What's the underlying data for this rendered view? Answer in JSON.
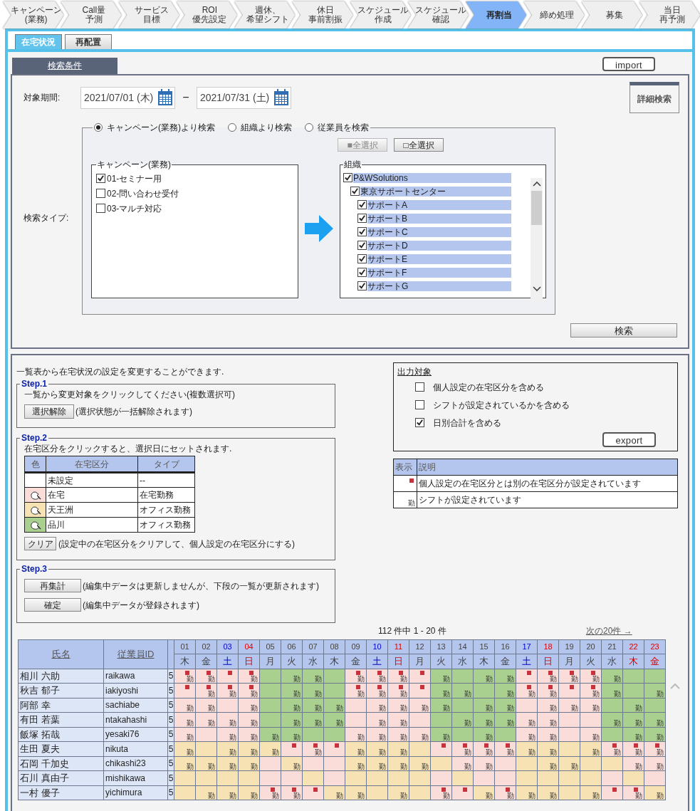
{
  "nav_tabs": [
    {
      "lines": [
        "キャンペーン",
        "(業務)"
      ],
      "selected": false
    },
    {
      "lines": [
        "Call量",
        "予測"
      ],
      "selected": false
    },
    {
      "lines": [
        "サービス",
        "目標"
      ],
      "selected": false
    },
    {
      "lines": [
        "ROI",
        "優先設定"
      ],
      "selected": false
    },
    {
      "lines": [
        "週休、",
        "希望シフト"
      ],
      "selected": false
    },
    {
      "lines": [
        "休日",
        "事前割振"
      ],
      "selected": false
    },
    {
      "lines": [
        "スケジュール",
        "作成"
      ],
      "selected": false
    },
    {
      "lines": [
        "スケジュール",
        "確認"
      ],
      "selected": false
    },
    {
      "lines": [
        "再割当"
      ],
      "selected": true
    },
    {
      "lines": [
        "締め処理"
      ],
      "selected": false
    },
    {
      "lines": [
        "募集"
      ],
      "selected": false
    },
    {
      "lines": [
        "当日",
        "再予測"
      ],
      "selected": false
    }
  ],
  "sub_tabs": [
    {
      "label": "在宅状況",
      "selected": true
    },
    {
      "label": "再配置",
      "selected": false
    }
  ],
  "search_panel": {
    "title": "検索条件",
    "import_button": "import",
    "detail_search_button": "詳細検索",
    "period_label": "対象期間:",
    "date_from": "2021/07/01 (木)",
    "separator": "−",
    "date_to": "2021/07/31 (土)",
    "type_label": "検索タイプ:",
    "search_types": [
      {
        "label": "キャンペーン(業務)より検索",
        "selected": true
      },
      {
        "label": "組織より検索",
        "selected": false
      },
      {
        "label": "従業員を検索",
        "selected": false
      }
    ],
    "select_all_button": {
      "label": "■全選択",
      "disabled": true
    },
    "deselect_all_button": {
      "label": "□全選択",
      "disabled": false
    },
    "campaign_list": {
      "title": "キャンペーン(業務)",
      "items": [
        {
          "label": "01-セミナー用",
          "checked": true
        },
        {
          "label": "02-問い合わせ受付",
          "checked": false
        },
        {
          "label": "03-マルチ対応",
          "checked": false
        }
      ]
    },
    "org_list": {
      "title": "組織",
      "items": [
        {
          "label": "P&WSolutions",
          "checked": true,
          "children": [
            {
              "label": "東京サポートセンター",
              "checked": true,
              "children": [
                {
                  "label": "サポートA",
                  "checked": true
                },
                {
                  "label": "サポートB",
                  "checked": true
                },
                {
                  "label": "サポートC",
                  "checked": true
                },
                {
                  "label": "サポートD",
                  "checked": true
                },
                {
                  "label": "サポートE",
                  "checked": true
                },
                {
                  "label": "サポートF",
                  "checked": true
                },
                {
                  "label": "サポートG",
                  "checked": true
                }
              ]
            }
          ]
        }
      ]
    },
    "search_button": "検索"
  },
  "intro": "一覧表から在宅状況の設定を変更することができます.",
  "step1": {
    "title": "Step.1",
    "instruction": "一覧から変更対象をクリックしてください(複数選択可)",
    "button": "選択解除",
    "note": "(選択状態が一括解除されます)"
  },
  "step2": {
    "title": "Step.2",
    "instruction": "在宅区分をクリックすると、選択日にセットされます.",
    "columns": [
      "色",
      "在宅区分",
      "タイプ"
    ],
    "rows": [
      {
        "kind": "unset",
        "color": "#ffffff",
        "zone": "未設定",
        "type": "--"
      },
      {
        "kind": "zone",
        "color": "#fadcd9",
        "zone": "在宅",
        "type": "在宅勤務"
      },
      {
        "kind": "zone",
        "color": "#f6e2b3",
        "zone": "天王洲",
        "type": "オフィス勤務"
      },
      {
        "kind": "zone",
        "color": "#a9d08e",
        "zone": "品川",
        "type": "オフィス勤務"
      }
    ],
    "button": "クリア",
    "note": "(設定中の在宅区分をクリアして、個人設定の在宅区分にする)"
  },
  "step3": {
    "title": "Step.3",
    "actions": [
      {
        "button": "再集計",
        "note": "(編集中データは更新しませんが、下段の一覧が更新されます)"
      },
      {
        "button": "確定",
        "note": "(編集中データが登録されます)"
      }
    ]
  },
  "output": {
    "title": "出力対象",
    "options": [
      {
        "label": "個人設定の在宅区分を含める",
        "checked": false
      },
      {
        "label": "シフトが設定されているかを含める",
        "checked": false
      },
      {
        "label": "日別合計を含める",
        "checked": true
      }
    ],
    "export_button": "export"
  },
  "legend": {
    "columns": [
      "表示",
      "説明"
    ],
    "rows": [
      {
        "kind": "mark",
        "description": "個人設定の在宅区分とは別の在宅区分が設定されています"
      },
      {
        "kind": "shift",
        "symbol": "勤",
        "description": "シフトが設定されています"
      }
    ]
  },
  "pagination": {
    "summary": "112 件中 1 - 20 件",
    "next_link": "次の20件 →"
  },
  "table": {
    "columns": [
      "氏名",
      "従業員ID"
    ],
    "days": [
      {
        "day": "01",
        "weekday": "木",
        "kind": "weekday"
      },
      {
        "day": "02",
        "weekday": "金",
        "kind": "weekday"
      },
      {
        "day": "03",
        "weekday": "土",
        "kind": "saturday"
      },
      {
        "day": "04",
        "weekday": "日",
        "kind": "holiday"
      },
      {
        "day": "05",
        "weekday": "月",
        "kind": "weekday"
      },
      {
        "day": "06",
        "weekday": "火",
        "kind": "weekday"
      },
      {
        "day": "07",
        "weekday": "水",
        "kind": "weekday"
      },
      {
        "day": "08",
        "weekday": "木",
        "kind": "weekday"
      },
      {
        "day": "09",
        "weekday": "金",
        "kind": "weekday"
      },
      {
        "day": "10",
        "weekday": "土",
        "kind": "saturday"
      },
      {
        "day": "11",
        "weekday": "日",
        "kind": "holiday"
      },
      {
        "day": "12",
        "weekday": "月",
        "kind": "weekday"
      },
      {
        "day": "13",
        "weekday": "火",
        "kind": "weekday"
      },
      {
        "day": "14",
        "weekday": "水",
        "kind": "weekday"
      },
      {
        "day": "15",
        "weekday": "木",
        "kind": "weekday"
      },
      {
        "day": "16",
        "weekday": "金",
        "kind": "weekday"
      },
      {
        "day": "17",
        "weekday": "土",
        "kind": "saturday"
      },
      {
        "day": "18",
        "weekday": "日",
        "kind": "holiday"
      },
      {
        "day": "19",
        "weekday": "月",
        "kind": "weekday"
      },
      {
        "day": "20",
        "weekday": "火",
        "kind": "weekday"
      },
      {
        "day": "21",
        "weekday": "水",
        "kind": "weekday"
      },
      {
        "day": "22",
        "weekday": "木",
        "kind": "holiday"
      },
      {
        "day": "23",
        "weekday": "金",
        "kind": "holiday"
      }
    ],
    "rows": [
      {
        "name": "相川 六助",
        "id": "raikawa",
        "count": "5",
        "cells": [
          {
            "color": "#fadcd9",
            "changed": true,
            "shift": "勤"
          },
          {
            "color": "#fadcd9",
            "changed": true,
            "shift": "勤"
          },
          {
            "color": "#fadcd9",
            "changed": true
          },
          {
            "color": "#fadcd9",
            "changed": true,
            "shift": "勤"
          },
          {
            "color": "#a9d08e",
            "changed": false
          },
          {
            "color": "#a9d08e",
            "changed": false,
            "shift": "勤"
          },
          {
            "color": "#a9d08e",
            "changed": false,
            "shift": "勤"
          },
          {
            "color": "#a9d08e",
            "changed": false
          },
          {
            "color": "#fadcd9",
            "changed": true,
            "shift": "勤"
          },
          {
            "color": "#fadcd9",
            "changed": true,
            "shift": "勤"
          },
          {
            "color": "#fadcd9",
            "changed": true,
            "shift": "勤"
          },
          {
            "color": "#fadcd9",
            "changed": true
          },
          {
            "color": "#a9d08e",
            "changed": false,
            "shift": "勤"
          },
          {
            "color": "#a9d08e",
            "changed": false
          },
          {
            "color": "#a9d08e",
            "changed": false,
            "shift": "勤"
          },
          {
            "color": "#a9d08e",
            "changed": false,
            "shift": "勤"
          },
          {
            "color": "#fadcd9",
            "changed": true
          },
          {
            "color": "#fadcd9",
            "changed": true,
            "shift": "勤"
          },
          {
            "color": "#fadcd9",
            "changed": true,
            "shift": "勤"
          },
          {
            "color": "#fadcd9",
            "changed": true,
            "shift": "勤"
          },
          {
            "color": "#a9d08e",
            "changed": false,
            "shift": "勤"
          },
          {
            "color": "#a9d08e",
            "changed": false
          },
          {
            "color": "#a9d08e",
            "changed": false
          }
        ]
      },
      {
        "name": "秋吉 郁子",
        "id": "iakiyoshi",
        "count": "5",
        "cells": [
          {
            "color": "#fadcd9",
            "changed": true
          },
          {
            "color": "#fadcd9",
            "changed": true,
            "shift": "勤"
          },
          {
            "color": "#fadcd9",
            "changed": true,
            "shift": "勤"
          },
          {
            "color": "#fadcd9",
            "changed": true,
            "shift": "勤"
          },
          {
            "color": "#a9d08e",
            "changed": false
          },
          {
            "color": "#a9d08e",
            "changed": false,
            "shift": "勤"
          },
          {
            "color": "#a9d08e",
            "changed": false,
            "shift": "勤"
          },
          {
            "color": "#a9d08e",
            "changed": false
          },
          {
            "color": "#fadcd9",
            "changed": true,
            "shift": "勤"
          },
          {
            "color": "#fadcd9",
            "changed": true,
            "shift": "勤"
          },
          {
            "color": "#fadcd9",
            "changed": true,
            "shift": "勤"
          },
          {
            "color": "#fadcd9",
            "changed": true
          },
          {
            "color": "#a9d08e",
            "changed": false,
            "shift": "勤"
          },
          {
            "color": "#a9d08e",
            "changed": false,
            "shift": "勤"
          },
          {
            "color": "#a9d08e",
            "changed": false
          },
          {
            "color": "#a9d08e",
            "changed": false,
            "shift": "勤"
          },
          {
            "color": "#fadcd9",
            "changed": true,
            "shift": "勤"
          },
          {
            "color": "#fadcd9",
            "changed": true,
            "shift": "勤"
          },
          {
            "color": "#fadcd9",
            "changed": true
          },
          {
            "color": "#fadcd9",
            "changed": true,
            "shift": "勤"
          },
          {
            "color": "#a9d08e",
            "changed": false,
            "shift": "勤"
          },
          {
            "color": "#a9d08e",
            "changed": false
          },
          {
            "color": "#a9d08e",
            "changed": false,
            "shift": "勤"
          }
        ]
      },
      {
        "name": "阿部 幸",
        "id": "sachiabe",
        "count": "5",
        "cells": [
          {
            "color": "#fadcd9",
            "changed": false,
            "shift": "勤"
          },
          {
            "color": "#fadcd9",
            "changed": false,
            "shift": "勤"
          },
          {
            "color": "#fadcd9",
            "changed": false
          },
          {
            "color": "#fadcd9",
            "changed": false,
            "shift": "勤"
          },
          {
            "color": "#a9d08e",
            "changed": false
          },
          {
            "color": "#a9d08e",
            "changed": false,
            "shift": "勤"
          },
          {
            "color": "#a9d08e",
            "changed": false,
            "shift": "勤"
          },
          {
            "color": "#a9d08e",
            "changed": false,
            "shift": "勤"
          },
          {
            "color": "#fadcd9",
            "changed": false
          },
          {
            "color": "#fadcd9",
            "changed": false,
            "shift": "勤"
          },
          {
            "color": "#fadcd9",
            "changed": false,
            "shift": "勤"
          },
          {
            "color": "#fadcd9",
            "changed": false,
            "shift": "勤"
          },
          {
            "color": "#a9d08e",
            "changed": false,
            "shift": "勤"
          },
          {
            "color": "#a9d08e",
            "changed": false
          },
          {
            "color": "#a9d08e",
            "changed": false,
            "shift": "勤"
          },
          {
            "color": "#a9d08e",
            "changed": false,
            "shift": "勤"
          },
          {
            "color": "#fadcd9",
            "changed": false
          },
          {
            "color": "#fadcd9",
            "changed": false,
            "shift": "勤"
          },
          {
            "color": "#fadcd9",
            "changed": false,
            "shift": "勤"
          },
          {
            "color": "#fadcd9",
            "changed": false,
            "shift": "勤"
          },
          {
            "color": "#a9d08e",
            "changed": false
          },
          {
            "color": "#a9d08e",
            "changed": false,
            "shift": "勤"
          },
          {
            "color": "#a9d08e",
            "changed": false
          }
        ]
      },
      {
        "name": "有田 若葉",
        "id": "ntakahashi",
        "count": "5",
        "cells": [
          {
            "color": "#fadcd9",
            "changed": false,
            "shift": "勤"
          },
          {
            "color": "#fadcd9",
            "changed": false,
            "shift": "勤"
          },
          {
            "color": "#fadcd9",
            "changed": false,
            "shift": "勤"
          },
          {
            "color": "#fadcd9",
            "changed": false,
            "shift": "勤"
          },
          {
            "color": "#a9d08e",
            "changed": false
          },
          {
            "color": "#a9d08e",
            "changed": false,
            "shift": "勤"
          },
          {
            "color": "#a9d08e",
            "changed": false,
            "shift": "勤"
          },
          {
            "color": "#a9d08e",
            "changed": false,
            "shift": "勤"
          },
          {
            "color": "#fadcd9",
            "changed": false
          },
          {
            "color": "#fadcd9",
            "changed": false,
            "shift": "勤"
          },
          {
            "color": "#fadcd9",
            "changed": false,
            "shift": "勤"
          },
          {
            "color": "#fadcd9",
            "changed": false
          },
          {
            "color": "#a9d08e",
            "changed": false
          },
          {
            "color": "#a9d08e",
            "changed": false,
            "shift": "勤"
          },
          {
            "color": "#a9d08e",
            "changed": false,
            "shift": "勤"
          },
          {
            "color": "#a9d08e",
            "changed": false,
            "shift": "勤"
          },
          {
            "color": "#fadcd9",
            "changed": false,
            "shift": "勤"
          },
          {
            "color": "#fadcd9",
            "changed": false,
            "shift": "勤"
          },
          {
            "color": "#fadcd9",
            "changed": false
          },
          {
            "color": "#fadcd9",
            "changed": false
          },
          {
            "color": "#a9d08e",
            "changed": false,
            "shift": "勤"
          },
          {
            "color": "#a9d08e",
            "changed": false,
            "shift": "勤"
          },
          {
            "color": "#a9d08e",
            "changed": false,
            "shift": "勤"
          }
        ]
      },
      {
        "name": "飯塚 拓哉",
        "id": "yesaki76",
        "count": "5",
        "cells": [
          {
            "color": "#fadcd9",
            "changed": false,
            "shift": "勤"
          },
          {
            "color": "#fadcd9",
            "changed": false
          },
          {
            "color": "#fadcd9",
            "changed": false,
            "shift": "勤"
          },
          {
            "color": "#fadcd9",
            "changed": false,
            "shift": "勤"
          },
          {
            "color": "#a9d08e",
            "changed": false,
            "shift": "勤"
          },
          {
            "color": "#a9d08e",
            "changed": false,
            "shift": "勤"
          },
          {
            "color": "#a9d08e",
            "changed": false
          },
          {
            "color": "#a9d08e",
            "changed": false
          },
          {
            "color": "#fadcd9",
            "changed": false,
            "shift": "勤"
          },
          {
            "color": "#fadcd9",
            "changed": false,
            "shift": "勤"
          },
          {
            "color": "#fadcd9",
            "changed": false,
            "shift": "勤"
          },
          {
            "color": "#fadcd9",
            "changed": false,
            "shift": "勤"
          },
          {
            "color": "#a9d08e",
            "changed": false,
            "shift": "勤"
          },
          {
            "color": "#a9d08e",
            "changed": false
          },
          {
            "color": "#a9d08e",
            "changed": false,
            "shift": "勤"
          },
          {
            "color": "#a9d08e",
            "changed": false
          },
          {
            "color": "#fadcd9",
            "changed": false,
            "shift": "勤"
          },
          {
            "color": "#fadcd9",
            "changed": false,
            "shift": "勤"
          },
          {
            "color": "#fadcd9",
            "changed": false
          },
          {
            "color": "#fadcd9",
            "changed": false,
            "shift": "勤"
          },
          {
            "color": "#a9d08e",
            "changed": false
          },
          {
            "color": "#a9d08e",
            "changed": false,
            "shift": "勤"
          },
          {
            "color": "#a9d08e",
            "changed": false,
            "shift": "勤"
          }
        ]
      },
      {
        "name": "生田 夏夫",
        "id": "nikuta",
        "count": "5",
        "cells": [
          {
            "color": "#f6e2b3",
            "changed": false,
            "shift": "勤"
          },
          {
            "color": "#f6e2b3",
            "changed": false
          },
          {
            "color": "#f6e2b3",
            "changed": false,
            "shift": "勤"
          },
          {
            "color": "#f6e2b3",
            "changed": false,
            "shift": "勤"
          },
          {
            "color": "#f6e2b3",
            "changed": false,
            "shift": "勤"
          },
          {
            "color": "#fadcd9",
            "changed": true
          },
          {
            "color": "#fadcd9",
            "changed": true,
            "shift": "勤"
          },
          {
            "color": "#fadcd9",
            "changed": true
          },
          {
            "color": "#f6e2b3",
            "changed": false,
            "shift": "勤"
          },
          {
            "color": "#f6e2b3",
            "changed": false,
            "shift": "勤"
          },
          {
            "color": "#f6e2b3",
            "changed": false,
            "shift": "勤"
          },
          {
            "color": "#f6e2b3",
            "changed": false
          },
          {
            "color": "#fadcd9",
            "changed": true
          },
          {
            "color": "#fadcd9",
            "changed": true,
            "shift": "勤"
          },
          {
            "color": "#fadcd9",
            "changed": true,
            "shift": "勤"
          },
          {
            "color": "#fadcd9",
            "changed": true,
            "shift": "勤"
          },
          {
            "color": "#f6e2b3",
            "changed": false,
            "shift": "勤"
          },
          {
            "color": "#f6e2b3",
            "changed": false,
            "shift": "勤"
          },
          {
            "color": "#f6e2b3",
            "changed": false
          },
          {
            "color": "#f6e2b3",
            "changed": false,
            "shift": "勤"
          },
          {
            "color": "#fadcd9",
            "changed": true,
            "shift": "勤"
          },
          {
            "color": "#fadcd9",
            "changed": true,
            "shift": "勤"
          },
          {
            "color": "#fadcd9",
            "changed": true,
            "shift": "勤"
          }
        ]
      },
      {
        "name": "石岡 千加史",
        "id": "chikashi23",
        "count": "5",
        "cells": [
          {
            "color": "#f6e2b3",
            "changed": false,
            "shift": "勤"
          },
          {
            "color": "#f6e2b3",
            "changed": false,
            "shift": "勤"
          },
          {
            "color": "#f6e2b3",
            "changed": false,
            "shift": "勤"
          },
          {
            "color": "#f6e2b3",
            "changed": false,
            "shift": "勤"
          },
          {
            "color": "#fadcd9",
            "changed": false
          },
          {
            "color": "#f6e2b3",
            "changed": false,
            "shift": "勤"
          },
          {
            "color": "#fadcd9",
            "changed": false
          },
          {
            "color": "#fadcd9",
            "changed": false
          },
          {
            "color": "#f6e2b3",
            "changed": false,
            "shift": "勤"
          },
          {
            "color": "#f6e2b3",
            "changed": false,
            "shift": "勤"
          },
          {
            "color": "#f6e2b3",
            "changed": false,
            "shift": "勤"
          },
          {
            "color": "#f6e2b3",
            "changed": false,
            "shift": "勤"
          },
          {
            "color": "#f6e2b3",
            "changed": false
          },
          {
            "color": "#fadcd9",
            "changed": false,
            "shift": "勤"
          },
          {
            "color": "#fadcd9",
            "changed": false,
            "shift": "勤"
          },
          {
            "color": "#fadcd9",
            "changed": false
          },
          {
            "color": "#f6e2b3",
            "changed": false
          },
          {
            "color": "#f6e2b3",
            "changed": false,
            "shift": "勤"
          },
          {
            "color": "#f6e2b3",
            "changed": false,
            "shift": "勤"
          },
          {
            "color": "#f6e2b3",
            "changed": false
          },
          {
            "color": "#f6e2b3",
            "changed": false
          },
          {
            "color": "#fadcd9",
            "changed": false,
            "shift": "勤"
          },
          {
            "color": "#fadcd9",
            "changed": false,
            "shift": "勤"
          }
        ]
      },
      {
        "name": "石川 真由子",
        "id": "mishikawa",
        "count": "5",
        "cells": [
          {
            "color": "#f6e2b3",
            "changed": false
          },
          {
            "color": "#f6e2b3",
            "changed": false
          },
          {
            "color": "#f6e2b3",
            "changed": false
          },
          {
            "color": "#f6e2b3",
            "changed": false
          },
          {
            "color": "#fadcd9",
            "changed": false
          },
          {
            "color": "#fadcd9",
            "changed": false
          },
          {
            "color": "#f6e2b3",
            "changed": false
          },
          {
            "color": "#fadcd9",
            "changed": false
          },
          {
            "color": "#f6e2b3",
            "changed": false
          },
          {
            "color": "#f6e2b3",
            "changed": false
          },
          {
            "color": "#f6e2b3",
            "changed": false
          },
          {
            "color": "#f6e2b3",
            "changed": false
          },
          {
            "color": "#fadcd9",
            "changed": false
          },
          {
            "color": "#f6e2b3",
            "changed": false
          },
          {
            "color": "#fadcd9",
            "changed": false
          },
          {
            "color": "#fadcd9",
            "changed": false
          },
          {
            "color": "#f6e2b3",
            "changed": false
          },
          {
            "color": "#f6e2b3",
            "changed": false
          },
          {
            "color": "#f6e2b3",
            "changed": false
          },
          {
            "color": "#f6e2b3",
            "changed": false
          },
          {
            "color": "#fadcd9",
            "changed": false
          },
          {
            "color": "#f6e2b3",
            "changed": false
          },
          {
            "color": "#fadcd9",
            "changed": false
          }
        ]
      },
      {
        "name": "一村 優子",
        "id": "yichimura",
        "count": "5",
        "cells": [
          {
            "color": "#f6e2b3",
            "changed": false
          },
          {
            "color": "#f6e2b3",
            "changed": false,
            "shift": "勤"
          },
          {
            "color": "#f6e2b3",
            "changed": false,
            "shift": "勤"
          },
          {
            "color": "#f6e2b3",
            "changed": false,
            "shift": "勤"
          },
          {
            "color": "#fadcd9",
            "changed": true,
            "shift": "勤"
          },
          {
            "color": "#fadcd9",
            "changed": true,
            "shift": "勤"
          },
          {
            "color": "#fadcd9",
            "changed": true
          },
          {
            "color": "#f6e2b3",
            "changed": false,
            "shift": "勤"
          },
          {
            "color": "#f6e2b3",
            "changed": false,
            "shift": "勤"
          },
          {
            "color": "#f6e2b3",
            "changed": false
          },
          {
            "color": "#f6e2b3",
            "changed": false,
            "shift": "勤"
          },
          {
            "color": "#f6e2b3",
            "changed": false
          },
          {
            "color": "#fadcd9",
            "changed": true,
            "shift": "勤"
          },
          {
            "color": "#fadcd9",
            "changed": true
          },
          {
            "color": "#f6e2b3",
            "changed": false,
            "shift": "勤"
          },
          {
            "color": "#fadcd9",
            "changed": true,
            "shift": "勤"
          },
          {
            "color": "#f6e2b3",
            "changed": false,
            "shift": "勤"
          },
          {
            "color": "#f6e2b3",
            "changed": false,
            "shift": "勤"
          },
          {
            "color": "#f6e2b3",
            "changed": false
          },
          {
            "color": "#f6e2b3",
            "changed": false,
            "shift": "勤"
          },
          {
            "color": "#fadcd9",
            "changed": true
          },
          {
            "color": "#fadcd9",
            "changed": true,
            "shift": "勤"
          },
          {
            "color": "#f6e2b3",
            "changed": false,
            "shift": "勤"
          }
        ]
      }
    ]
  }
}
